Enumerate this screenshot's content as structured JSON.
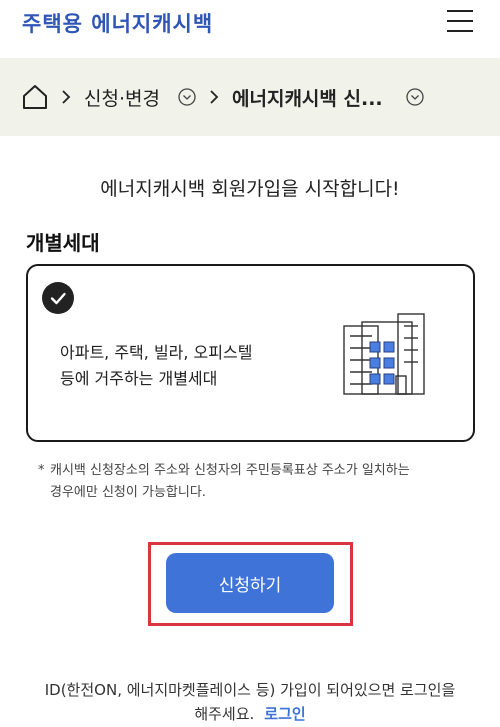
{
  "header": {
    "logo": "주택용 에너지캐시백",
    "menu_icon": "hamburger-menu-icon"
  },
  "breadcrumb": {
    "home_icon": "home-icon",
    "items": [
      {
        "label": "신청·변경"
      },
      {
        "label": "에너지캐시백 신..."
      }
    ]
  },
  "main": {
    "title": "에너지캐시백 회원가입을 시작합니다!",
    "section_label": "개별세대",
    "card": {
      "selected": true,
      "line1": "아파트, 주택, 빌라, 오피스텔",
      "line2": "등에 거주하는 개별세대",
      "icon": "apartment-building-icon"
    },
    "notice": {
      "star": "*",
      "line1": "캐시백 신청장소의 주소와 신청자의 주민등록표상 주소가 일치하는",
      "line2": "경우에만 신청이 가능합니다."
    },
    "apply_button": "신청하기",
    "bottom": {
      "line1": "ID(한전ON, 에너지마켓플레이스 등) 가입이 되어있으면 로그인을",
      "line2": "해주세요.",
      "login": "로그인"
    }
  },
  "colors": {
    "brand": "#2f56b6",
    "button": "#3f73d8",
    "highlight": "#d9343f",
    "breadcrumb_bg": "#f1f3ea"
  }
}
